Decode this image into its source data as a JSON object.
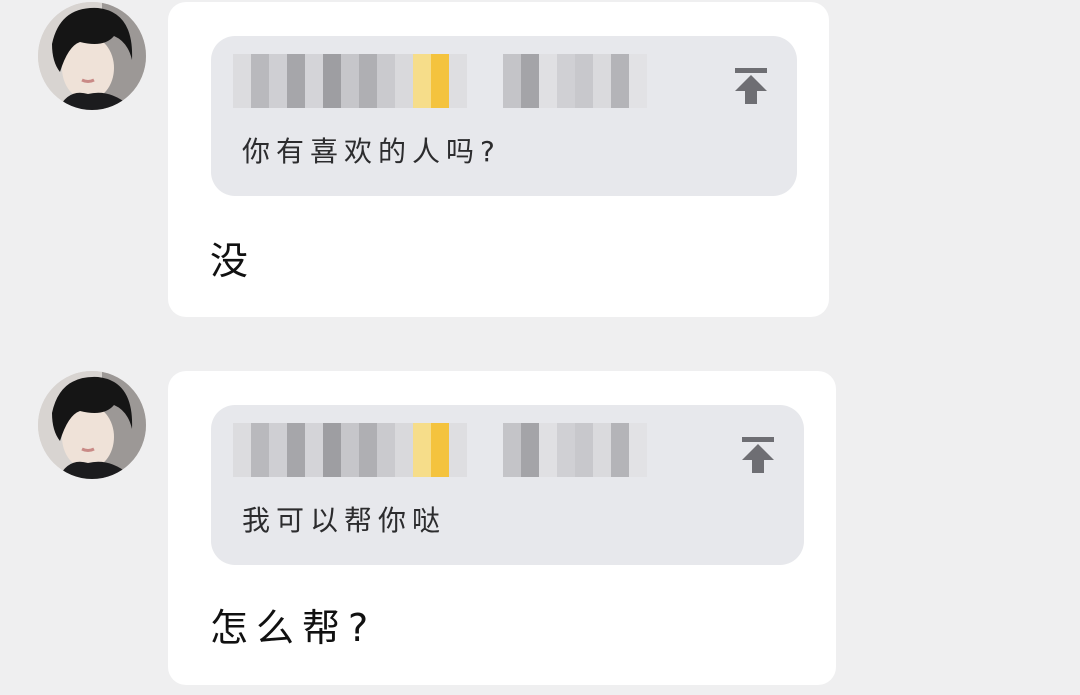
{
  "messages": [
    {
      "quoted_text": "你有喜欢的人吗?",
      "reply_text": "没",
      "quoted_sender_blurred": true
    },
    {
      "quoted_text": "我可以帮你哒",
      "reply_text": "怎么帮?",
      "quoted_sender_blurred": true
    }
  ],
  "icons": {
    "jump_to_quote": "arrow-up-to-top-icon",
    "avatar": "user-avatar-photo"
  },
  "colors": {
    "background": "#efeff0",
    "bubble": "#ffffff",
    "quote_background": "#e7e8ec",
    "icon": "#6e6e73",
    "blur_accent": "#f5c542"
  }
}
